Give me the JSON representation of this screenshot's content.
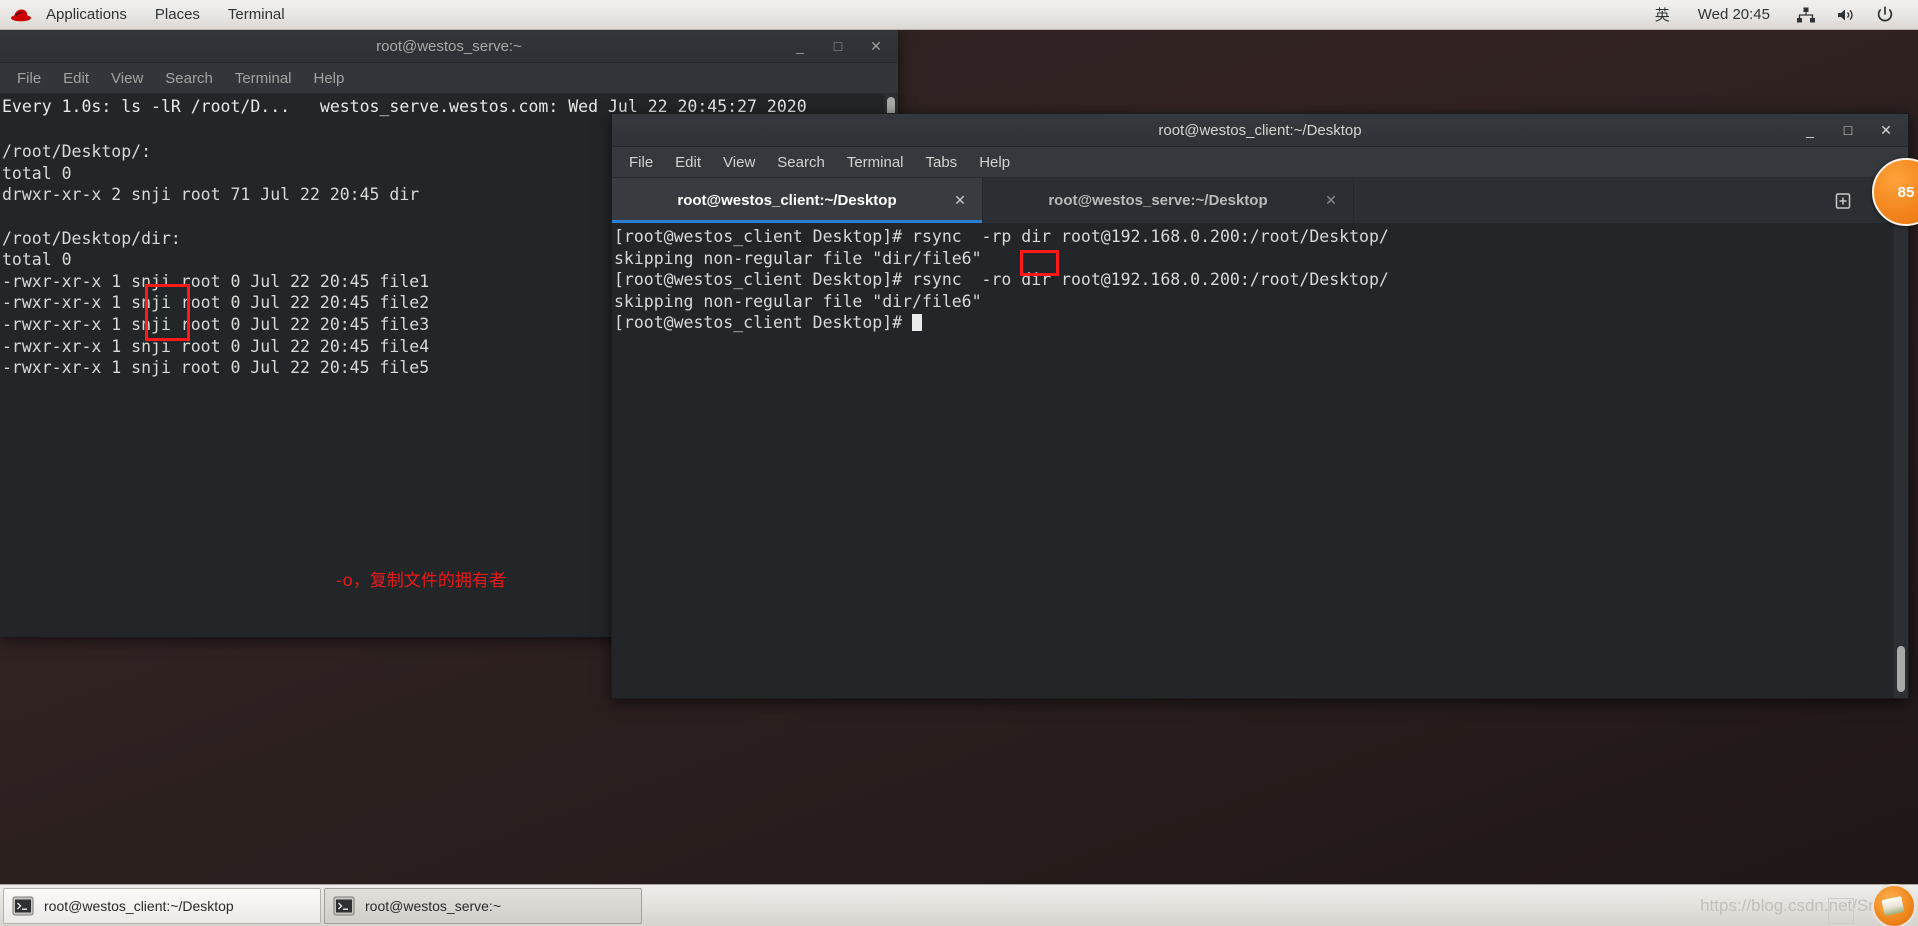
{
  "top_panel": {
    "logo_name": "red-hat-logo",
    "items": [
      {
        "label": "Applications",
        "name": "applications-menu"
      },
      {
        "label": "Places",
        "name": "places-menu"
      },
      {
        "label": "Terminal",
        "name": "terminal-menu"
      }
    ],
    "ime": "英",
    "clock": "Wed 20:45",
    "tray": [
      {
        "name": "network-icon"
      },
      {
        "name": "volume-icon"
      },
      {
        "name": "power-icon"
      }
    ]
  },
  "serve_window": {
    "title": "root@westos_serve:~",
    "menu": [
      "File",
      "Edit",
      "View",
      "Search",
      "Terminal",
      "Help"
    ],
    "buttons": {
      "minimize": "_",
      "maximize": "□",
      "close": "✕"
    },
    "watch_header": "Every 1.0s: ls -lR /root/D...   westos_serve.westos.com: Wed Jul 22 20:45:27 2020",
    "terminal_lines": [
      "",
      "/root/Desktop/:",
      "total 0",
      "drwxr-xr-x 2 snji root 71 Jul 22 20:45 dir",
      "",
      "/root/Desktop/dir:",
      "total 0",
      "-rwxr-xr-x 1 snji root 0 Jul 22 20:45 file1",
      "-rwxr-xr-x 1 snji root 0 Jul 22 20:45 file2",
      "-rwxr-xr-x 1 snji root 0 Jul 22 20:45 file3",
      "-rwxr-xr-x 1 snji root 0 Jul 22 20:45 file4",
      "-rwxr-xr-x 1 snji root 0 Jul 22 20:45 file5"
    ]
  },
  "client_window": {
    "title": "root@westos_client:~/Desktop",
    "menu": [
      "File",
      "Edit",
      "View",
      "Search",
      "Terminal",
      "Tabs",
      "Help"
    ],
    "buttons": {
      "minimize": "_",
      "maximize": "□",
      "close": "✕"
    },
    "tabs": [
      {
        "label": "root@westos_client:~/Desktop",
        "active": true,
        "close": "✕"
      },
      {
        "label": "root@westos_serve:~/Desktop",
        "active": false,
        "close": "✕"
      }
    ],
    "tab_actions": [
      {
        "name": "new-tab-icon"
      },
      {
        "name": "chevron-down-icon"
      }
    ],
    "terminal_lines": [
      "[root@westos_client Desktop]# rsync  -rp dir root@192.168.0.200:/root/Desktop/",
      "skipping non-regular file \"dir/file6\"",
      "[root@westos_client Desktop]# rsync  -ro dir root@192.168.0.200:/root/Desktop/",
      "skipping non-regular file \"dir/file6\"",
      "[root@westos_client Desktop]# "
    ]
  },
  "annotations": {
    "note_text": "-o，复制文件的拥有者",
    "note_color": "#e81919",
    "box_color": "#ff1a1a"
  },
  "side_badge": {
    "value": "85"
  },
  "taskbar": {
    "buttons": [
      {
        "label": "root@westos_client:~/Desktop",
        "active": false,
        "icon": "terminal-icon"
      },
      {
        "label": "root@westos_serve:~",
        "active": true,
        "icon": "terminal-icon"
      }
    ],
    "watermark": "https://blog.csdn.net/Snji_G"
  }
}
